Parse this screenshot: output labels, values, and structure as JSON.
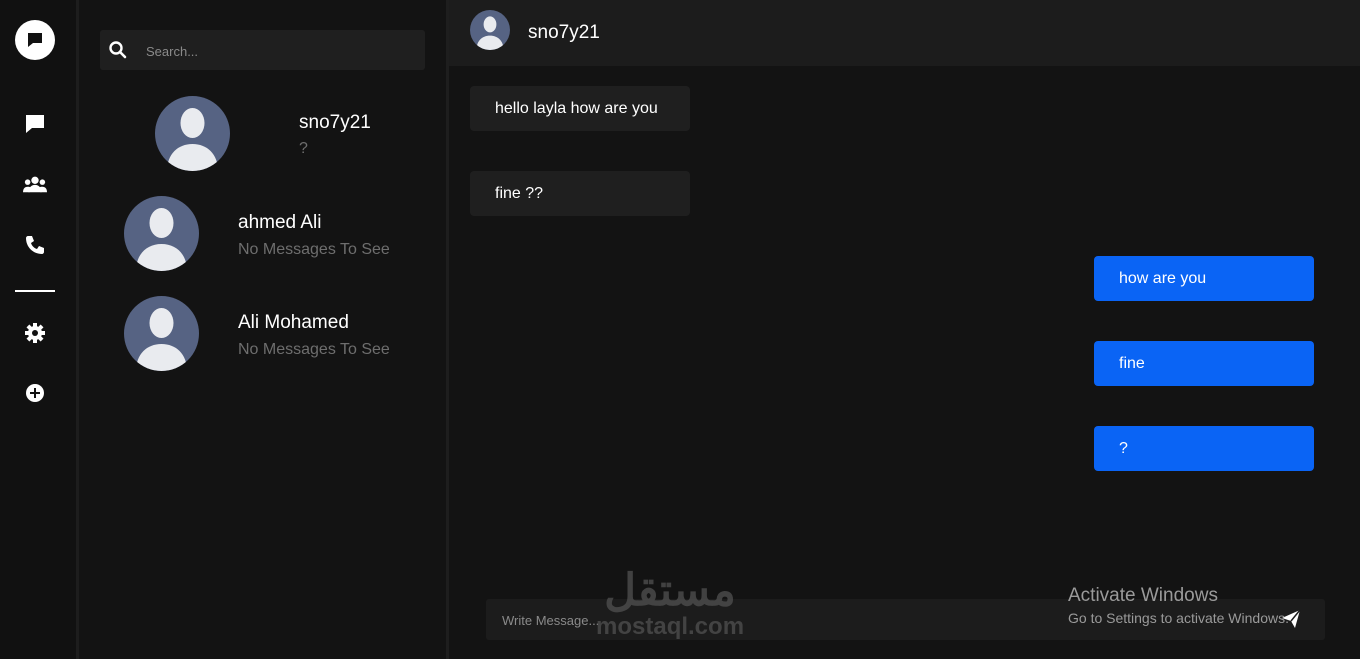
{
  "rail": {
    "items": [
      "chat-icon",
      "users-icon",
      "phone-icon",
      "gear-icon",
      "plus-circle-icon"
    ]
  },
  "search": {
    "placeholder": "Search..."
  },
  "contacts": [
    {
      "name": "sno7y21",
      "last_message": "?"
    },
    {
      "name": "ahmed Ali",
      "last_message": "No Messages To See"
    },
    {
      "name": "Ali Mohamed",
      "last_message": "No Messages To See"
    }
  ],
  "conversation": {
    "title": "sno7y21",
    "messages": [
      {
        "direction": "incoming",
        "text": "hello layla how are you"
      },
      {
        "direction": "incoming",
        "text": "fine ??"
      },
      {
        "direction": "outgoing",
        "text": "how are you"
      },
      {
        "direction": "outgoing",
        "text": "fine"
      },
      {
        "direction": "outgoing",
        "text": "?"
      }
    ]
  },
  "composer": {
    "placeholder": "Write Message..."
  },
  "overlay": {
    "activate_title": "Activate Windows",
    "activate_subtitle": "Go to Settings to activate Windows.",
    "watermark_arabic": "مستقل",
    "watermark_latin": "mostaql.com"
  },
  "colors": {
    "accent": "#0a64f5",
    "background": "#131313",
    "avatar": "#566383"
  }
}
